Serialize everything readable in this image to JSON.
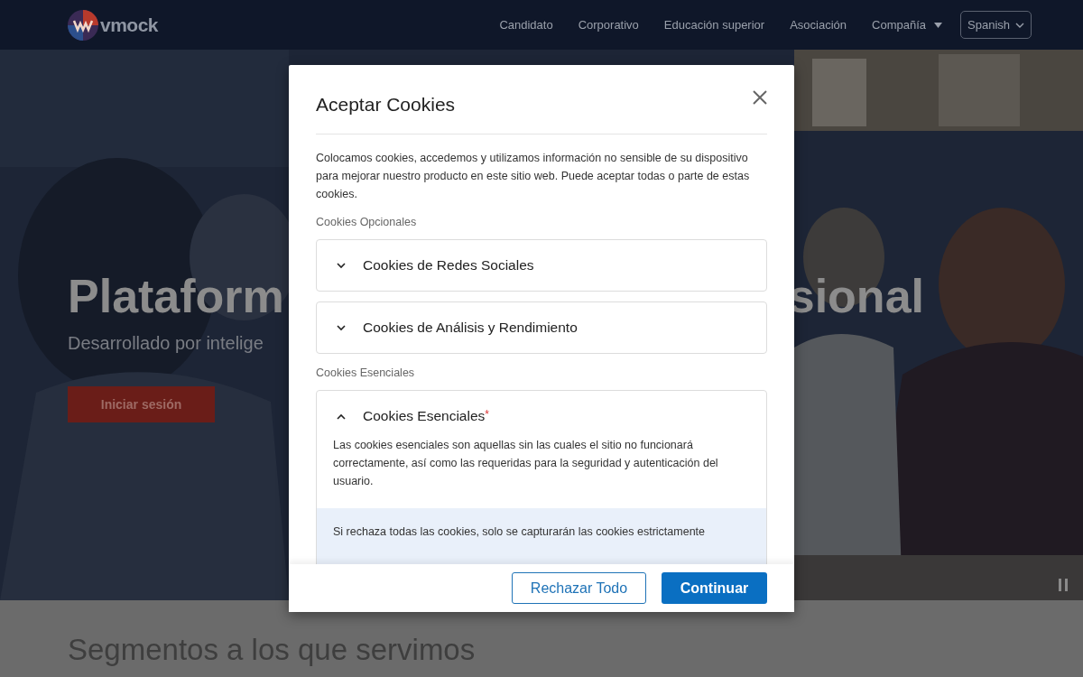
{
  "nav": {
    "logo": "vmock",
    "links": [
      {
        "label": "Candidato",
        "dropdown": false
      },
      {
        "label": "Corporativo",
        "dropdown": false
      },
      {
        "label": "Educación superior",
        "dropdown": false
      },
      {
        "label": "Asociación",
        "dropdown": false
      },
      {
        "label": "Compañía",
        "dropdown": true
      }
    ],
    "language": "Spanish"
  },
  "hero": {
    "title_left": "Plataform",
    "title_right": "sional",
    "subtitle": "Desarrollado por intelige",
    "button": "Iniciar sesión"
  },
  "section": {
    "heading": "Segmentos a los que servimos"
  },
  "modal": {
    "title": "Aceptar Cookies",
    "intro": "Colocamos cookies, accedemos y utilizamos información no sensible de su dispositivo para mejorar nuestro producto en este sitio web. Puede aceptar todas o parte de estas cookies.",
    "groups": [
      {
        "heading": "Cookies Opcionales",
        "items": [
          {
            "label": "Cookies de Redes Sociales",
            "expanded": false
          },
          {
            "label": "Cookies de Análisis y Rendimiento",
            "expanded": false
          }
        ]
      },
      {
        "heading": "Cookies Esenciales",
        "items": [
          {
            "label": "Cookies Esenciales",
            "required_mark": "*",
            "expanded": true,
            "description": "Las cookies esenciales son aquellas sin las cuales el sitio no funcionará correctamente, así como las requeridas para la seguridad y autenticación del usuario.",
            "notice": "Si rechaza todas las cookies, solo se capturarán las cookies estrictamente"
          }
        ]
      }
    ],
    "buttons": [
      {
        "label": "Rechazar Todo",
        "kind": "secondary"
      },
      {
        "label": "Continuar",
        "kind": "primary"
      }
    ]
  }
}
